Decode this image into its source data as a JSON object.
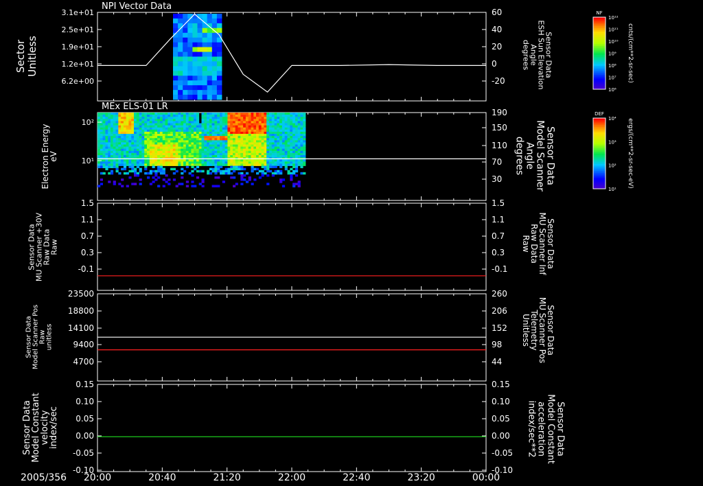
{
  "time_axis": {
    "date": "2005/356",
    "ticks": [
      "20:00",
      "20:40",
      "21:20",
      "22:00",
      "22:40",
      "23:20",
      "00:00"
    ]
  },
  "colors": {
    "background": "#000000",
    "white_trace": "#ffffff",
    "red_trace": "#ff2020",
    "green_trace": "#20e020"
  },
  "chart_data": [
    {
      "type": "heatmap",
      "panel_title": "NPI Vector Data",
      "ylabel": [
        "Sector",
        "Unitless"
      ],
      "yticks": [
        "3.1e+01",
        "2.5e+01",
        "1.9e+01",
        "1.2e+01",
        "6.2e+00"
      ],
      "data_time_range": [
        "20:45",
        "21:20"
      ],
      "colorbar": {
        "label": "NF",
        "unit": "cnts/(cm**2-sr-sec)",
        "ticks": [
          "10¹²",
          "10¹¹",
          "10¹⁰",
          "10⁹",
          "10⁸",
          "10⁷",
          "10⁶"
        ]
      },
      "overlay": {
        "type": "line",
        "ylabel_right": [
          "Sensor Data",
          "ESH Sun Elevation",
          "Angle",
          "degrees"
        ],
        "right_ticks": [
          60,
          40,
          20,
          0,
          -20
        ],
        "ylim": [
          -40,
          60
        ],
        "x_hours": [
          20.0,
          20.5,
          20.75,
          21.0,
          21.25,
          21.5,
          21.75,
          22.0,
          22.25,
          22.5,
          23.0,
          23.5,
          24.0
        ],
        "values": [
          0,
          0,
          30,
          58,
          35,
          -10,
          -30,
          0,
          0,
          0,
          1,
          0,
          0
        ]
      }
    },
    {
      "type": "heatmap",
      "panel_title": "MEx ELS-01 LR",
      "ylabel": [
        "Electron Energy",
        "eV"
      ],
      "yticks": [
        "10²",
        "10¹"
      ],
      "data_time_range": [
        "20:00",
        "22:06"
      ],
      "colorbar": {
        "label": "DEF",
        "unit": "ergs/(cm**2-sr-sec-eV)",
        "ticks": [
          "10⁴",
          "10³",
          "10²",
          "10¹"
        ]
      },
      "overlay": {
        "type": "line",
        "ylabel_right": [
          "Sensor Data",
          "Model Scanner",
          "Angle",
          "degrees"
        ],
        "right_ticks": [
          190,
          150,
          110,
          70,
          30
        ],
        "ylim": [
          0,
          190
        ],
        "x_hours": [
          20.0,
          24.0
        ],
        "values": [
          90,
          90
        ]
      }
    },
    {
      "type": "line",
      "ylabel": [
        "Sensor Data",
        "MU Scanner +30V",
        "Raw Data",
        "Raw"
      ],
      "yticks": [
        "1.5",
        "1.1",
        "0.7",
        "0.3",
        "-0.1"
      ],
      "ylim": [
        -0.3,
        1.5
      ],
      "ylabel_right": [
        "Sensor Data",
        "MU Scanner Inf",
        "Raw Data",
        "Raw"
      ],
      "right_ticks": [
        "1.5",
        "1.1",
        "0.7",
        "0.3",
        "-0.1"
      ],
      "series": [
        {
          "color": "#ff2020",
          "x_hours": [
            20.0,
            24.0
          ],
          "values": [
            0.0,
            0.0
          ]
        }
      ]
    },
    {
      "type": "line",
      "ylabel": [
        "Sensor Data",
        "Model Scanner Pos",
        "Raw",
        "unitless"
      ],
      "yticks": [
        "23500",
        "18800",
        "14100",
        "9400",
        "4700"
      ],
      "ylim": [
        0,
        23500
      ],
      "ylabel_right": [
        "Sensor Data",
        "MU Scanner Pos",
        "Telemetry",
        "Unitless"
      ],
      "right_ticks": [
        "260",
        "206",
        "152",
        "98",
        "44"
      ],
      "series": [
        {
          "color": "#ffffff",
          "x_hours": [
            20.0,
            24.0
          ],
          "values": [
            11800,
            11800
          ]
        },
        {
          "color": "#ff2020",
          "x_hours": [
            20.0,
            24.0
          ],
          "values": [
            8400,
            8400
          ]
        }
      ]
    },
    {
      "type": "line",
      "ylabel": [
        "Sensor Data",
        "Model Constant",
        "velocity",
        "index/sec"
      ],
      "yticks": [
        "0.15",
        "0.10",
        "0.05",
        "0.00",
        "-0.05",
        "-0.10"
      ],
      "ylim": [
        -0.1,
        0.15
      ],
      "ylabel_right": [
        "Sensor Data",
        "Model Constant",
        "acceleration",
        "index/sec**2"
      ],
      "right_ticks": [
        "0.15",
        "0.10",
        "0.05",
        "0.00",
        "-0.05",
        "-0.10"
      ],
      "series": [
        {
          "color": "#20e020",
          "x_hours": [
            20.0,
            24.0
          ],
          "values": [
            0.0,
            0.0
          ]
        }
      ]
    }
  ]
}
